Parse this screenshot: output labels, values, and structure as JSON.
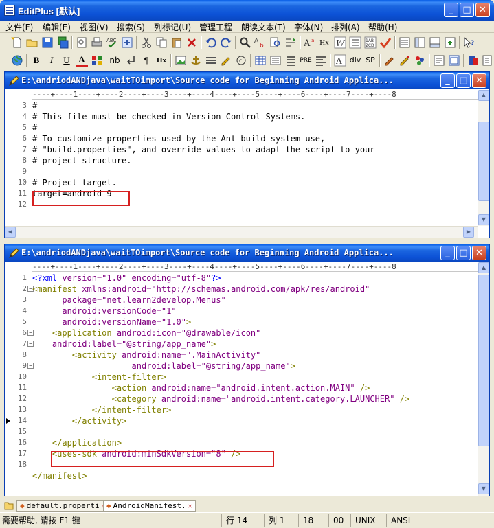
{
  "app": {
    "title": "EditPlus [默认]"
  },
  "menu": [
    "文件(F)",
    "编辑(E)",
    "视图(V)",
    "搜索(S)",
    "列标记(U)",
    "管理工程",
    "朗读文本(T)",
    "字体(N)",
    "排列(A)",
    "帮助(H)"
  ],
  "toolbar2_text": {
    "bold": "B",
    "italic": "I",
    "underline": "U",
    "font_color": "A",
    "nb": "nb",
    "hx": "Hx",
    "div": "div",
    "sp": "SP",
    "pre": "PRE"
  },
  "child1": {
    "title": "E:\\andriodANDjava\\waitTOimport\\Source code for Beginning Android Applica...",
    "ruler": "----+----1----+----2----+----3----+----4----+----5----+----6----+----7----+----8",
    "lines": [
      {
        "n": "3",
        "text": "#"
      },
      {
        "n": "4",
        "text": "# This file must be checked in Version Control Systems."
      },
      {
        "n": "5",
        "text": "#"
      },
      {
        "n": "6",
        "text": "# To customize properties used by the Ant build system use,"
      },
      {
        "n": "7",
        "text": "# \"build.properties\", and override values to adapt the script to your"
      },
      {
        "n": "8",
        "text": "# project structure."
      },
      {
        "n": "9",
        "text": ""
      },
      {
        "n": "10",
        "text": "# Project target."
      },
      {
        "n": "11",
        "text": "target=android-9"
      },
      {
        "n": "12",
        "text": ""
      }
    ]
  },
  "child2": {
    "title": "E:\\andriodANDjava\\waitTOimport\\Source code for Beginning Android Applica...",
    "ruler": "----+----1----+----2----+----3----+----4----+----5----+----6----+----7----+----8",
    "lines": [
      {
        "n": "1"
      },
      {
        "n": "2"
      },
      {
        "n": "3"
      },
      {
        "n": "4"
      },
      {
        "n": "5"
      },
      {
        "n": "6"
      },
      {
        "n": "7"
      },
      {
        "n": "8"
      },
      {
        "n": "9"
      },
      {
        "n": "10"
      },
      {
        "n": "11"
      },
      {
        "n": "12"
      },
      {
        "n": "13"
      },
      {
        "n": "14"
      },
      {
        "n": "15"
      },
      {
        "n": "16"
      },
      {
        "n": "17"
      },
      {
        "n": "18"
      }
    ],
    "xml": {
      "l1_a": "<?xml",
      "l1_b": "version",
      "l1_c": "=\"1.0\"",
      "l1_d": "encoding",
      "l1_e": "=\"utf-8\"",
      "l1_f": "?>",
      "l2_a": "<manifest",
      "l2_b": "xmlns:android",
      "l2_c": "=\"http://schemas.android.com/apk/res/android\"",
      "l3_a": "package",
      "l3_b": "=\"net.learn2develop.Menus\"",
      "l4_a": "android:versionCode",
      "l4_b": "=\"1\"",
      "l5_a": "android:versionName",
      "l5_b": "=\"1.0\"",
      "l5_c": ">",
      "l6_a": "<application",
      "l6_b": "android:icon",
      "l6_c": "=\"@drawable/icon\"",
      "l7_a": "android:label",
      "l7_b": "=\"@string/app_name\"",
      "l7_c": ">",
      "l8_a": "<activity",
      "l8_b": "android:name",
      "l8_c": "=\".MainActivity\"",
      "l9_a": "android:label",
      "l9_b": "=\"@string/app_name\"",
      "l9_c": ">",
      "l10_a": "<intent-filter>",
      "l11_a": "<action",
      "l11_b": "android:name",
      "l11_c": "=\"android.intent.action.MAIN\"",
      "l11_d": "/>",
      "l12_a": "<category",
      "l12_b": "android:name",
      "l12_c": "=\"android.intent.category.LAUNCHER\"",
      "l12_d": "/>",
      "l13_a": "</intent-filter>",
      "l14_a": "</activity>",
      "l16_a": "</application>",
      "l17_a": "<uses-sdk",
      "l17_b": "android:minSdkVersion",
      "l17_c": "=\"8\"",
      "l17_d": "/>",
      "l19_a": "</manifest>"
    }
  },
  "tabs": [
    {
      "label": "default.properti"
    },
    {
      "label": "AndroidManifest."
    }
  ],
  "status": {
    "help": "需要帮助, 请按 F1 键",
    "line_label": "行 14",
    "col_label": "列 1",
    "length": "18",
    "code": "00",
    "eol": "UNIX",
    "encoding": "ANSI"
  }
}
